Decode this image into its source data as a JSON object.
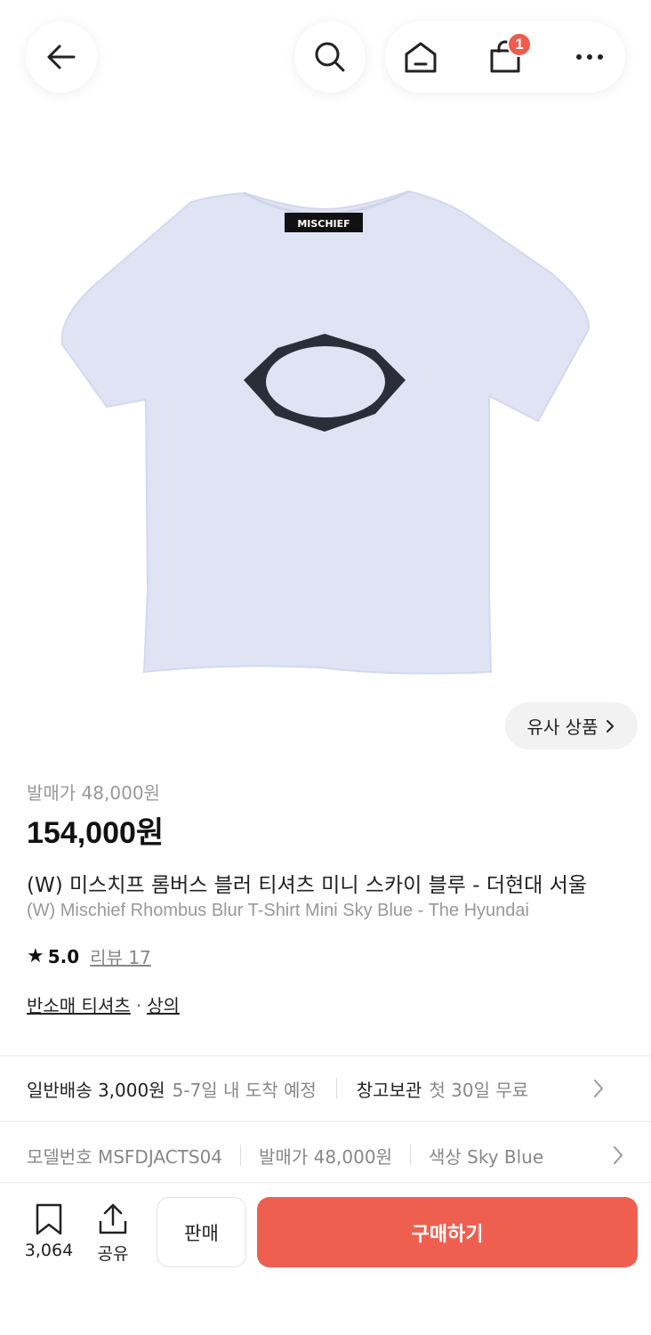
{
  "header": {
    "back_icon": "arrow-left-icon",
    "search_icon": "search-icon",
    "home_icon": "home-icon",
    "cart_icon": "shopping-bag-icon",
    "cart_badge": "1",
    "more_icon": "more-dots-icon"
  },
  "product": {
    "image_logo": "MISCHIEF",
    "similar_label": "유사 상품",
    "original_price": "발매가 48,000원",
    "price": "154,000원",
    "title_ko": "(W) 미스치프 롬버스 블러 티셔츠 미니 스카이 블루 - 더현대 서울",
    "title_en": "(W) Mischief Rhombus Blur T-Shirt Mini Sky Blue - The Hyundai",
    "rating_score": "5.0",
    "review_label": "리뷰 17",
    "category_primary": "반소매 티셔츠",
    "category_dot": "·",
    "category_secondary": "상의"
  },
  "shipping": {
    "label": "일반배송 3,000원",
    "eta": "5-7일 내 도착 예정",
    "storage_label": "창고보관",
    "storage_note": "첫 30일 무료"
  },
  "details": {
    "model": "모델번호 MSFDJACTS04",
    "release_price": "발매가 48,000원",
    "color": "색상 Sky Blue"
  },
  "bottom": {
    "bookmark_count": "3,064",
    "share_label": "공유",
    "sell_label": "판매",
    "buy_label": "구매하기"
  },
  "colors": {
    "accent": "#ef5f50",
    "badge": "#ef5b4c",
    "shirt": "#dfe3f3"
  }
}
